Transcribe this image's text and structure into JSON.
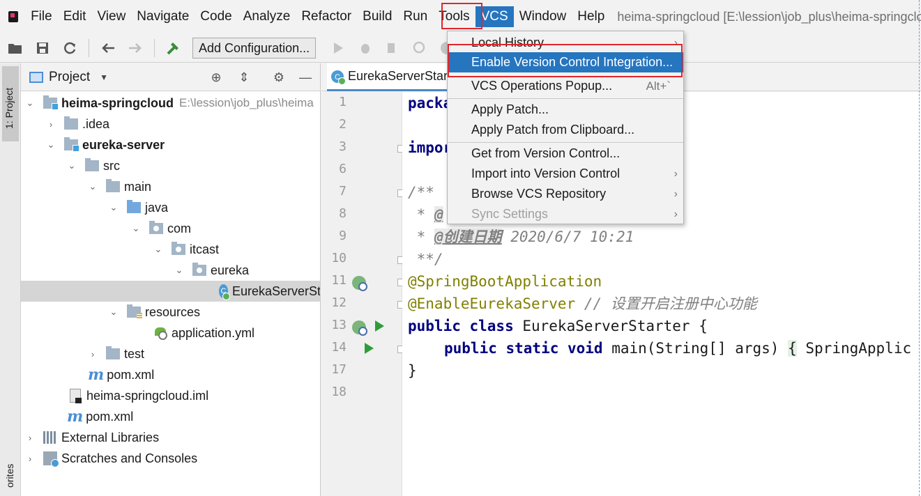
{
  "menubar": {
    "items": [
      "File",
      "Edit",
      "View",
      "Navigate",
      "Code",
      "Analyze",
      "Refactor",
      "Build",
      "Run",
      "Tools",
      "VCS",
      "Window",
      "Help"
    ],
    "active": "VCS",
    "window_title": "heima-springcloud [E:\\lession\\job_plus\\heima-springcloud] - ..."
  },
  "toolbar": {
    "config_label": "Add Configuration..."
  },
  "left_stripe": {
    "project_tab": "1: Project",
    "favorites_tab": "orites"
  },
  "project_panel": {
    "title": "Project",
    "tree": [
      {
        "label": "heima-springcloud",
        "hint": "E:\\lession\\job_plus\\heima",
        "bold": true
      },
      {
        "label": ".idea"
      },
      {
        "label": "eureka-server",
        "bold": true
      },
      {
        "label": "src"
      },
      {
        "label": "main"
      },
      {
        "label": "java"
      },
      {
        "label": "com"
      },
      {
        "label": "itcast"
      },
      {
        "label": "eureka"
      },
      {
        "label": "EurekaServerSt"
      },
      {
        "label": "resources"
      },
      {
        "label": "application.yml"
      },
      {
        "label": "test"
      },
      {
        "label": "pom.xml"
      },
      {
        "label": "heima-springcloud.iml"
      },
      {
        "label": "pom.xml"
      },
      {
        "label": "External Libraries"
      },
      {
        "label": "Scratches and Consoles"
      }
    ]
  },
  "editor": {
    "tab_label": "EurekaServerStar",
    "line_numbers": [
      "1",
      "2",
      "3",
      "6",
      "7",
      "8",
      "9",
      "10",
      "11",
      "12",
      "13",
      "14",
      "17",
      "18"
    ],
    "code": {
      "l1": "packa",
      "l3": "impor",
      "l7": "/**",
      "l8_star": " * ",
      "l8_tag": "@",
      "l9_star": " * ",
      "l9_tag": "@创建日期",
      "l9_text": " 2020/6/7 10:21",
      "l10": " **/",
      "l11": "@SpringBootApplication",
      "l12_ann": "@EnableEurekaServer",
      "l12_cmt": " // 设置开启注册中心功能",
      "l13_kw": "public class",
      "l13_rest": " EurekaServerStarter {",
      "l14_kw": "public static void",
      "l14_rest": " main(String[] args) ",
      "l14_brace": "{",
      "l14_tail": " SpringApplic",
      "l17": "}"
    }
  },
  "vcs_menu": {
    "items": [
      {
        "label": "Local History",
        "submenu": true
      },
      {
        "label": "Enable Version Control Integration...",
        "highlighted": true
      },
      {
        "label": "VCS Operations Popup...",
        "shortcut": "Alt+`"
      },
      {
        "label": "Apply Patch..."
      },
      {
        "label": "Apply Patch from Clipboard..."
      },
      {
        "label": "Get from Version Control..."
      },
      {
        "label": "Import into Version Control",
        "submenu": true
      },
      {
        "label": "Browse VCS Repository",
        "submenu": true
      },
      {
        "label": "Sync Settings",
        "submenu": true,
        "disabled": true
      }
    ]
  },
  "colors": {
    "menu_highlight": "#2675bf",
    "annotation_box": "#e0262c"
  }
}
